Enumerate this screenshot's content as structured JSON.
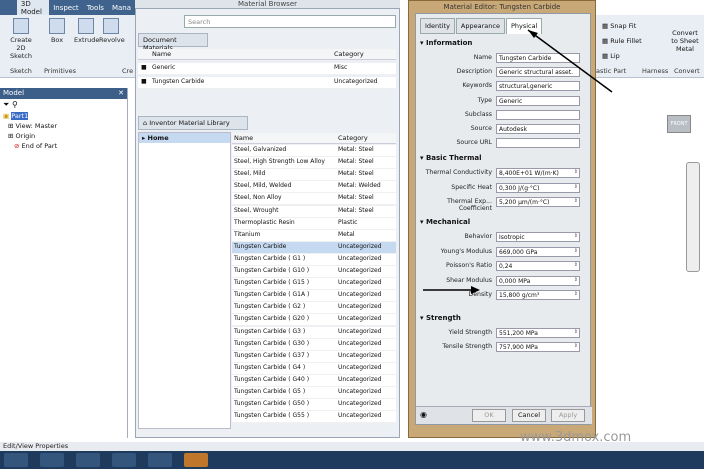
{
  "ribbon": {
    "tabs": [
      "3D Model",
      "Inspect",
      "Tools",
      "Mana"
    ],
    "buttons": [
      "Create 2D Sketch",
      "Box",
      "Extrude",
      "Revolve"
    ],
    "groups": [
      "Sketch",
      "Primitives",
      "Cre"
    ]
  },
  "model": {
    "title": "Model",
    "tree": [
      "Part1",
      "View: Master",
      "Origin",
      "End of Part"
    ]
  },
  "browser": {
    "title": "Material Browser",
    "search_placeholder": "Search",
    "doc_label": "Document Materials",
    "lib_label": "Inventor Material Library",
    "home": "Home",
    "headers": {
      "name": "Name",
      "category": "Category"
    },
    "doc_rows": [
      {
        "name": "Generic",
        "category": "Misc"
      },
      {
        "name": "Tungsten Carbide",
        "category": "Uncategorized"
      }
    ],
    "lib_rows": [
      {
        "name": "Steel, Galvanized",
        "category": "Metal: Steel"
      },
      {
        "name": "Steel, High Strength Low Alloy",
        "category": "Metal: Steel"
      },
      {
        "name": "Steel, Mild",
        "category": "Metal: Steel"
      },
      {
        "name": "Steel, Mild, Welded",
        "category": "Metal: Welded"
      },
      {
        "name": "Steel, Non Alloy",
        "category": "Metal: Steel"
      },
      {
        "name": "Steel, Wrought",
        "category": "Metal: Steel"
      },
      {
        "name": "Thermoplastic Resin",
        "category": "Plastic"
      },
      {
        "name": "Titanium",
        "category": "Metal"
      },
      {
        "name": "Tungsten Carbide",
        "category": "Uncategorized"
      },
      {
        "name": "Tungsten Carbide ( G1 )",
        "category": "Uncategorized"
      },
      {
        "name": "Tungsten Carbide ( G10 )",
        "category": "Uncategorized"
      },
      {
        "name": "Tungsten Carbide ( G15 )",
        "category": "Uncategorized"
      },
      {
        "name": "Tungsten Carbide ( G1A )",
        "category": "Uncategorized"
      },
      {
        "name": "Tungsten Carbide ( G2 )",
        "category": "Uncategorized"
      },
      {
        "name": "Tungsten Carbide ( G20 )",
        "category": "Uncategorized"
      },
      {
        "name": "Tungsten Carbide ( G3 )",
        "category": "Uncategorized"
      },
      {
        "name": "Tungsten Carbide ( G30 )",
        "category": "Uncategorized"
      },
      {
        "name": "Tungsten Carbide ( G37 )",
        "category": "Uncategorized"
      },
      {
        "name": "Tungsten Carbide ( G4 )",
        "category": "Uncategorized"
      },
      {
        "name": "Tungsten Carbide ( G40 )",
        "category": "Uncategorized"
      },
      {
        "name": "Tungsten Carbide ( G5 )",
        "category": "Uncategorized"
      },
      {
        "name": "Tungsten Carbide ( G50 )",
        "category": "Uncategorized"
      },
      {
        "name": "Tungsten Carbide ( G55 )",
        "category": "Uncategorized"
      }
    ]
  },
  "editor": {
    "title": "Material Editor: Tungsten Carbide",
    "tabs": [
      "Identity",
      "Appearance",
      "Physical"
    ],
    "info_title": "Information",
    "info": [
      {
        "l": "Name",
        "v": "Tungsten Carbide"
      },
      {
        "l": "Description",
        "v": "Generic structural asset."
      },
      {
        "l": "Keywords",
        "v": "structural,generic"
      },
      {
        "l": "Type",
        "v": "Generic"
      },
      {
        "l": "Subclass",
        "v": ""
      },
      {
        "l": "Source",
        "v": "Autodesk"
      },
      {
        "l": "Source URL",
        "v": ""
      }
    ],
    "thermal_title": "Basic Thermal",
    "thermal": [
      {
        "l": "Thermal Conductivity",
        "v": "8,400E+01 W/(m·K)"
      },
      {
        "l": "Specific Heat",
        "v": "0,300 J/(g·°C)"
      },
      {
        "l": "Thermal Exp... Coefficient",
        "v": "5,200 µm/(m·°C)"
      }
    ],
    "mech_title": "Mechanical",
    "mech": [
      {
        "l": "Behavior",
        "v": "Isotropic"
      },
      {
        "l": "Young's Modulus",
        "v": "669,000 GPa"
      },
      {
        "l": "Poisson's Ratio",
        "v": "0,24"
      },
      {
        "l": "Shear Modulus",
        "v": "0,000 MPa"
      },
      {
        "l": "Density",
        "v": "15,800 g/cm³"
      }
    ],
    "str_title": "Strength",
    "strength": [
      {
        "l": "Yield Strength",
        "v": "551,200 MPa"
      },
      {
        "l": "Tensile Strength",
        "v": "757,900 MPa"
      }
    ],
    "ok": "OK",
    "cancel": "Cancel",
    "apply": "Apply"
  },
  "right": {
    "items": [
      "Snap Fit",
      "Rule Fillet",
      "Lip",
      "Convert to Sheet Metal"
    ],
    "groups": [
      "astic Part",
      "Harness",
      "Convert"
    ],
    "view_cube": "FRONT"
  },
  "status": "Edit/View Properties",
  "watermark": "www.3dmox.com"
}
